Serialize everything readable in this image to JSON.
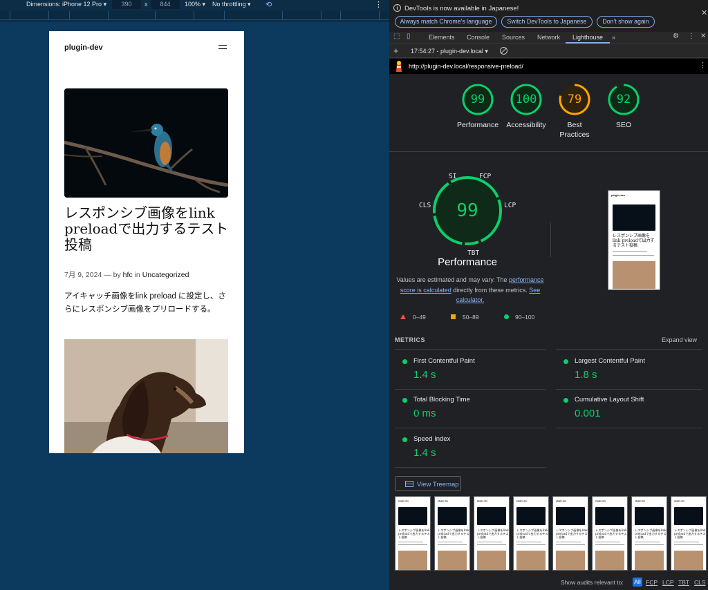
{
  "device_toolbar": {
    "dimensions_label": "Dimensions: iPhone 12 Pro",
    "width": "390",
    "times": "x",
    "height": "844",
    "zoom": "100%",
    "throttling": "No throttling"
  },
  "page": {
    "site_title": "plugin-dev",
    "post_title": "レスポンシブ画像をlink preloadで出力するテスト投稿",
    "meta_date": "7月 9, 2024",
    "meta_by": "— by",
    "meta_author": "hfc",
    "meta_in": "in",
    "meta_category": "Uncategorized",
    "excerpt": "アイキャッチ画像をlink preload に設定し、さらにレスポンシブ画像をプリロードする。"
  },
  "devtools": {
    "info_message": "DevTools is now available in Japanese!",
    "btn_always_match": "Always match Chrome's language",
    "btn_switch": "Switch DevTools to Japanese",
    "btn_dont_show": "Don't show again",
    "tabs": [
      "Elements",
      "Console",
      "Sources",
      "Network",
      "Lighthouse"
    ],
    "more_tabs": "»",
    "session": "17:54:27 - plugin-dev.local",
    "url": "http://plugin-dev.local/responsive-preload/"
  },
  "lighthouse": {
    "scores": [
      {
        "label": "Performance",
        "value": 99,
        "color": "#0cce6b"
      },
      {
        "label": "Accessibility",
        "value": 100,
        "color": "#0cce6b"
      },
      {
        "label": "Best Practices",
        "value": 79,
        "color": "#ffa400"
      },
      {
        "label": "SEO",
        "value": 92,
        "color": "#0cce6b"
      }
    ],
    "main_score": "99",
    "main_label": "Performance",
    "gauge_labels": {
      "si": "SI",
      "fcp": "FCP",
      "cls": "CLS",
      "lcp": "LCP",
      "tbt": "TBT"
    },
    "estimate_prefix": "Values are estimated and may vary. The",
    "estimate_link1": "performance score is calculated",
    "estimate_mid": "directly from these metrics.",
    "estimate_link2": "See calculator.",
    "legend": {
      "fail": "0–49",
      "average": "50–89",
      "pass": "90–100"
    },
    "metrics_title": "METRICS",
    "expand_view": "Expand view",
    "metrics": [
      {
        "name": "First Contentful Paint",
        "value": "1.4 s"
      },
      {
        "name": "Largest Contentful Paint",
        "value": "1.8 s"
      },
      {
        "name": "Total Blocking Time",
        "value": "0 ms"
      },
      {
        "name": "Cumulative Layout Shift",
        "value": "0.001"
      },
      {
        "name": "Speed Index",
        "value": "1.4 s"
      }
    ],
    "view_treemap": "View Treemap",
    "audits_label": "Show audits relevant to:",
    "audit_filters": [
      "All",
      "FCP",
      "LCP",
      "TBT",
      "CLS"
    ]
  }
}
